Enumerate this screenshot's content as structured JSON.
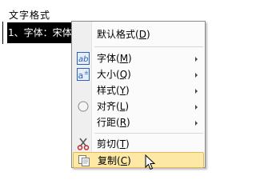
{
  "document": {
    "title": "文字格式",
    "selected_text": "1、字体：宋体"
  },
  "context_menu": {
    "items": [
      {
        "label": "默认格式(",
        "accel": "D",
        "suffix": ")",
        "submenu": false
      },
      {
        "label": "字体(",
        "accel": "M",
        "suffix": ")",
        "submenu": true
      },
      {
        "label": "大小(",
        "accel": "Q",
        "suffix": ")",
        "submenu": true
      },
      {
        "label": "样式(",
        "accel": "Y",
        "suffix": ")",
        "submenu": true
      },
      {
        "label": "对齐(",
        "accel": "L",
        "suffix": ")",
        "submenu": true
      },
      {
        "label": "行距(",
        "accel": "R",
        "suffix": ")",
        "submenu": true
      },
      {
        "label": "剪切(",
        "accel": "T",
        "suffix": ")",
        "submenu": false
      },
      {
        "label": "复制(",
        "accel": "C",
        "suffix": ")",
        "submenu": false
      }
    ],
    "hovered_item": "复制(C)",
    "colors": {
      "hover_bg": "#fde8a6",
      "hover_border": "#e6b84f",
      "icon_blue": "#2e62b5"
    }
  }
}
